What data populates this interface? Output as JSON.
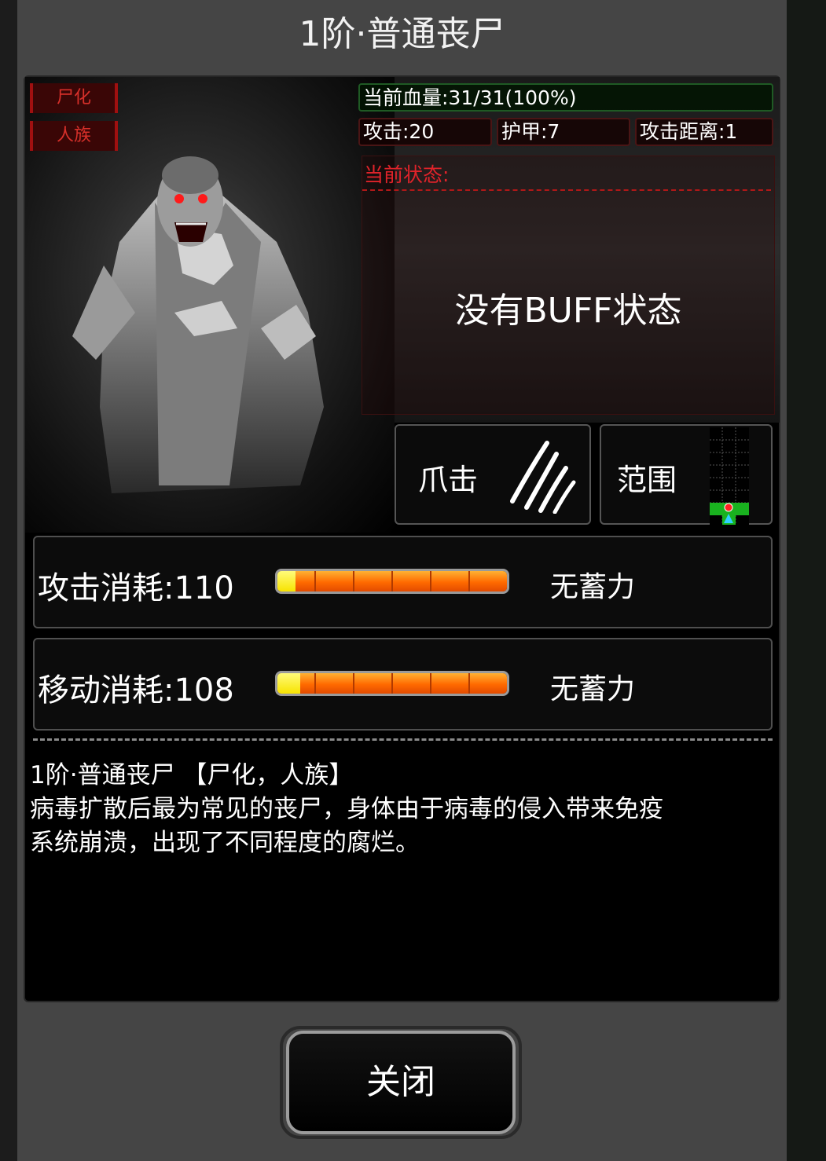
{
  "title": "1阶·普通丧尸",
  "tags": [
    "尸化",
    "人族"
  ],
  "stats": {
    "hp": "当前血量:31/31(100%)",
    "attack": "攻击:20",
    "armor": "护甲:7",
    "range": "攻击距离:1"
  },
  "status": {
    "label": "当前状态:",
    "empty_text": "没有BUFF状态"
  },
  "skills": [
    {
      "label": "爪击",
      "icon": "claw-icon"
    },
    {
      "label": "范围",
      "icon": "range-grid-icon"
    }
  ],
  "costs": [
    {
      "label": "攻击消耗:110",
      "fill": 0.08,
      "note": "无蓄力"
    },
    {
      "label": "移动消耗:108",
      "fill": 0.1,
      "note": "无蓄力"
    }
  ],
  "description": {
    "line1": "1阶·普通丧尸 【尸化，人族】",
    "line2": "病毒扩散后最为常见的丧尸，身体由于病毒的侵入带来免疫",
    "line3": "系统崩溃，出现了不同程度的腐烂。"
  },
  "close_label": "关闭",
  "colors": {
    "tag_red": "#d8302a",
    "status_red": "#e0232a",
    "hp_border": "#1f5a24",
    "bar_orange": "#ff6a00",
    "bar_yellow": "#f7e300"
  }
}
